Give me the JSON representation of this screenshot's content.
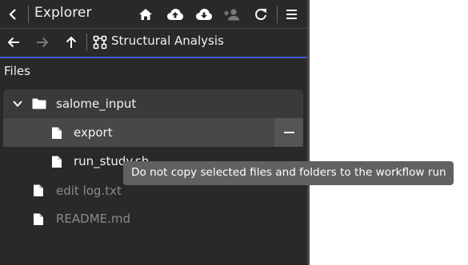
{
  "header": {
    "title": "Explorer"
  },
  "nav": {
    "breadcrumb": "Structural Analysis"
  },
  "files_section": {
    "label": "Files"
  },
  "tree": {
    "folder": {
      "name": "salome_input"
    },
    "folder_children": [
      {
        "name": "export"
      },
      {
        "name": "run_study.sh"
      }
    ],
    "root_files": [
      {
        "name": "edit log.txt"
      },
      {
        "name": "README.md"
      }
    ]
  },
  "tooltip": {
    "text": "Do not copy selected files and folders to the workflow run"
  },
  "icons": {
    "back": "chevron-left-icon",
    "home": "home-icon",
    "upload": "cloud-upload-icon",
    "download": "cloud-download-icon",
    "add_user": "person-add-icon",
    "refresh": "refresh-icon",
    "menu": "menu-icon",
    "nav_back": "arrow-left-icon",
    "nav_forward": "arrow-right-icon",
    "nav_up": "arrow-up-icon",
    "workflow": "workflow-icon",
    "expand": "chevron-down-icon",
    "folder": "folder-icon",
    "file": "file-icon",
    "exclude": "minus-icon"
  },
  "colors": {
    "panel_bg": "#292929",
    "accent": "#3d5bd6",
    "tooltip_bg": "#616161"
  }
}
